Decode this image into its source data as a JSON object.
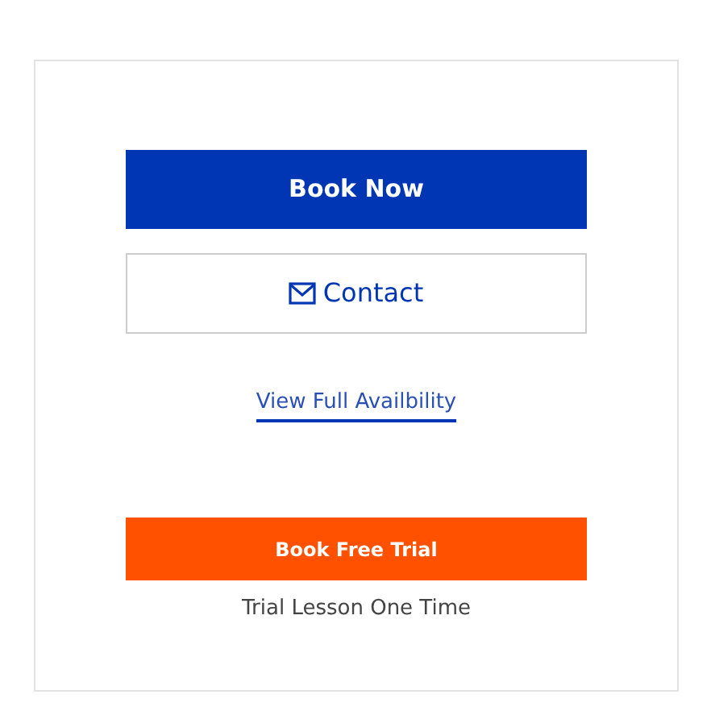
{
  "book_button": {
    "label": "Book Now"
  },
  "contact_button": {
    "label": "Contact"
  },
  "availability_link": {
    "label": "View Full Availbility"
  },
  "trial_button": {
    "label": "Book Free Trial"
  },
  "trial_note": "Trial Lesson One Time"
}
